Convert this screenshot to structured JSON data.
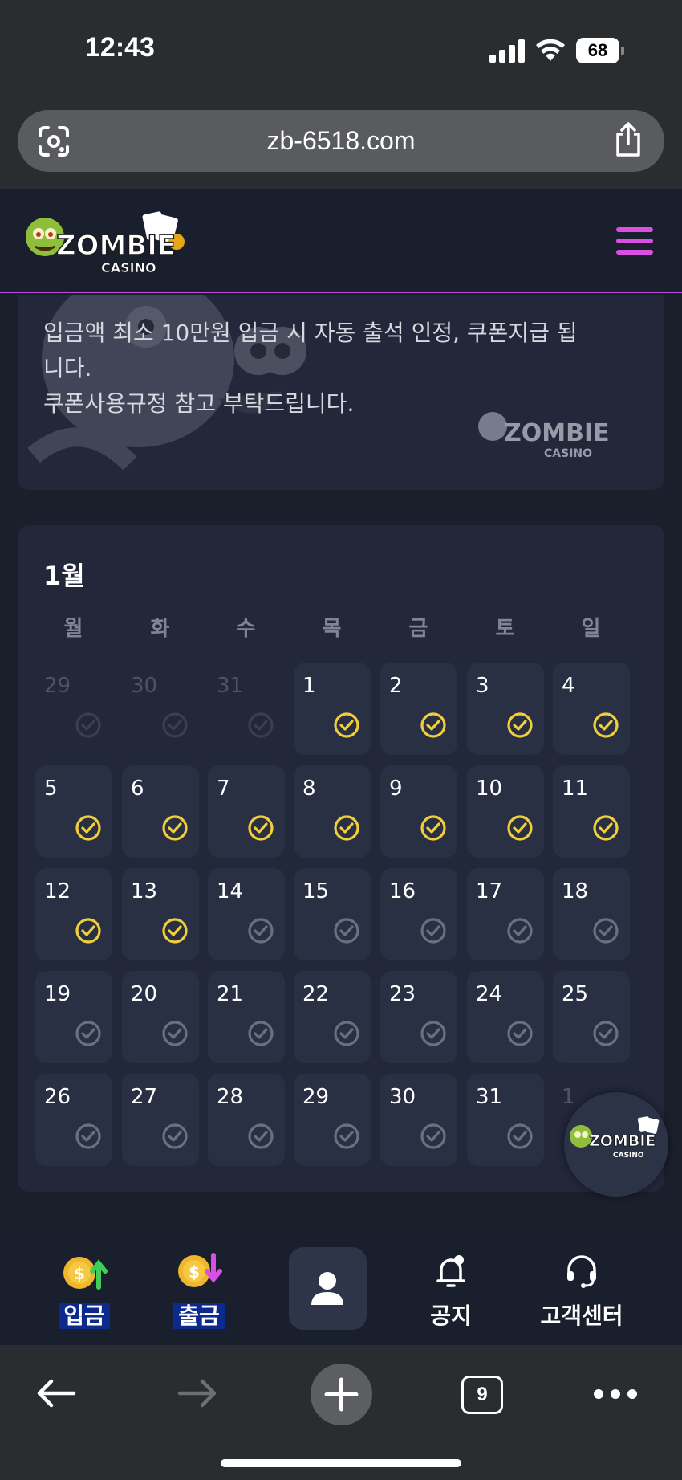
{
  "status_bar": {
    "time": "12:43",
    "battery": "68"
  },
  "browser": {
    "url": "zb-6518.com",
    "tab_count": "9"
  },
  "site": {
    "logo_main": "ZOMBIE",
    "logo_sub": "CASINO"
  },
  "notice": {
    "line1": "입금액 최소 10만원 입금 시 자동 출석 인정, 쿠폰지급 됩",
    "line2": "니다.",
    "line3": "쿠폰사용규정 참고 부탁드립니다."
  },
  "calendar": {
    "month": "1월",
    "weekdays": [
      "월",
      "화",
      "수",
      "목",
      "금",
      "토",
      "일"
    ],
    "days": [
      {
        "n": "29",
        "other": true,
        "checked": false
      },
      {
        "n": "30",
        "other": true,
        "checked": false
      },
      {
        "n": "31",
        "other": true,
        "checked": false
      },
      {
        "n": "1",
        "other": false,
        "checked": true
      },
      {
        "n": "2",
        "other": false,
        "checked": true
      },
      {
        "n": "3",
        "other": false,
        "checked": true
      },
      {
        "n": "4",
        "other": false,
        "checked": true
      },
      {
        "n": "5",
        "other": false,
        "checked": true
      },
      {
        "n": "6",
        "other": false,
        "checked": true
      },
      {
        "n": "7",
        "other": false,
        "checked": true
      },
      {
        "n": "8",
        "other": false,
        "checked": true
      },
      {
        "n": "9",
        "other": false,
        "checked": true
      },
      {
        "n": "10",
        "other": false,
        "checked": true
      },
      {
        "n": "11",
        "other": false,
        "checked": true
      },
      {
        "n": "12",
        "other": false,
        "checked": true
      },
      {
        "n": "13",
        "other": false,
        "checked": true
      },
      {
        "n": "14",
        "other": false,
        "checked": false
      },
      {
        "n": "15",
        "other": false,
        "checked": false
      },
      {
        "n": "16",
        "other": false,
        "checked": false
      },
      {
        "n": "17",
        "other": false,
        "checked": false
      },
      {
        "n": "18",
        "other": false,
        "checked": false
      },
      {
        "n": "19",
        "other": false,
        "checked": false
      },
      {
        "n": "20",
        "other": false,
        "checked": false
      },
      {
        "n": "21",
        "other": false,
        "checked": false
      },
      {
        "n": "22",
        "other": false,
        "checked": false
      },
      {
        "n": "23",
        "other": false,
        "checked": false
      },
      {
        "n": "24",
        "other": false,
        "checked": false
      },
      {
        "n": "25",
        "other": false,
        "checked": false
      },
      {
        "n": "26",
        "other": false,
        "checked": false
      },
      {
        "n": "27",
        "other": false,
        "checked": false
      },
      {
        "n": "28",
        "other": false,
        "checked": false
      },
      {
        "n": "29",
        "other": false,
        "checked": false
      },
      {
        "n": "30",
        "other": false,
        "checked": false
      },
      {
        "n": "31",
        "other": false,
        "checked": false
      },
      {
        "n": "1",
        "other": true,
        "checked": false
      }
    ]
  },
  "bottom_nav": {
    "deposit": "입금",
    "withdraw": "출금",
    "notice": "공지",
    "support": "고객센터"
  },
  "colors": {
    "accent": "#d84fe2",
    "check_active": "#f2cf3a",
    "check_inactive": "#6b7080",
    "card": "#22273a",
    "cell": "#2a3043"
  }
}
